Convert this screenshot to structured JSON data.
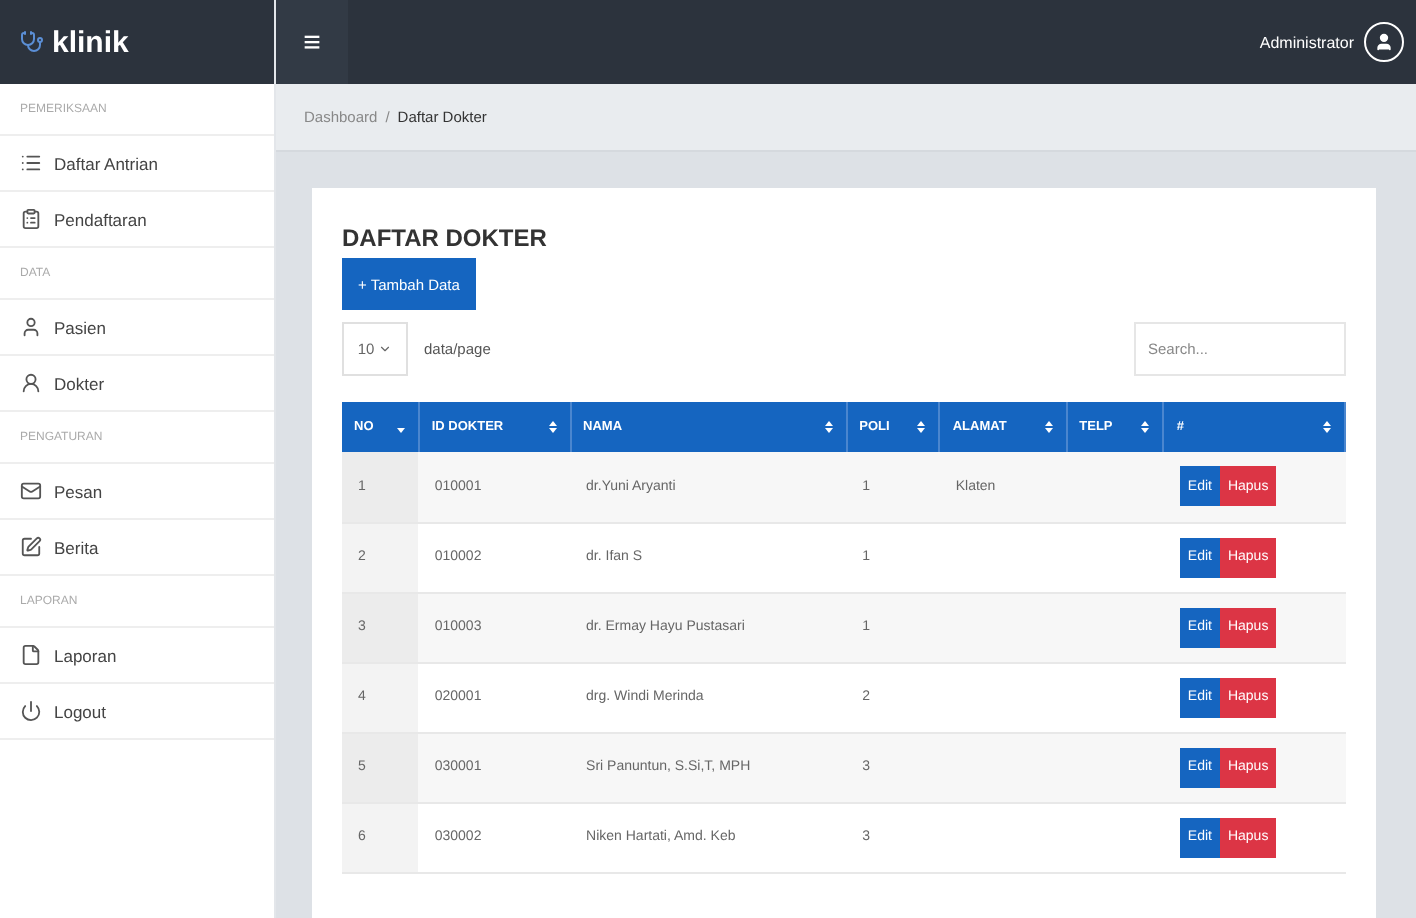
{
  "brand": "klinik",
  "topbar": {
    "menu_glyph": "≡",
    "user": "Administrator"
  },
  "sidebar": [
    {
      "kind": "header",
      "label": "PEMERIKSAAN"
    },
    {
      "kind": "item",
      "label": "Daftar Antrian"
    },
    {
      "kind": "item",
      "label": "Pendaftaran"
    },
    {
      "kind": "header",
      "label": "DATA"
    },
    {
      "kind": "item",
      "label": "Pasien"
    },
    {
      "kind": "item",
      "label": "Dokter"
    },
    {
      "kind": "header",
      "label": "PENGATURAN"
    },
    {
      "kind": "item",
      "label": "Pesan"
    },
    {
      "kind": "item",
      "label": "Berita"
    },
    {
      "kind": "header",
      "label": "LAPORAN"
    },
    {
      "kind": "item",
      "label": "Laporan"
    },
    {
      "kind": "item",
      "label": "Logout"
    }
  ],
  "breadcrumb": {
    "items": [
      "Dashboard",
      "Daftar Dokter"
    ],
    "separator": "/"
  },
  "page_title": "DAFTAR DOKTER",
  "add_button": "+ Tambah Data",
  "page_size": {
    "value": "10",
    "label": "data/page"
  },
  "search": {
    "placeholder": "Search..."
  },
  "table": {
    "columns": [
      {
        "label": "NO",
        "sorted": true
      },
      {
        "label": "ID DOKTER",
        "sorted": false
      },
      {
        "label": "NAMA",
        "sorted": false
      },
      {
        "label": "POLI",
        "sorted": false
      },
      {
        "label": "ALAMAT",
        "sorted": false
      },
      {
        "label": "TELP",
        "sorted": false
      },
      {
        "label": "#",
        "sorted": false
      }
    ],
    "rows": [
      {
        "cells": [
          "1",
          "010001",
          "dr.Yuni Aryanti",
          "1",
          "Klaten",
          ""
        ],
        "actions": [
          "Edit",
          "Hapus"
        ]
      },
      {
        "cells": [
          "2",
          "010002",
          "dr. Ifan S",
          "1",
          "",
          ""
        ],
        "actions": [
          "Edit",
          "Hapus"
        ]
      },
      {
        "cells": [
          "3",
          "010003",
          "dr. Ermay Hayu Pustasari",
          "1",
          "",
          ""
        ],
        "actions": [
          "Edit",
          "Hapus"
        ]
      },
      {
        "cells": [
          "4",
          "020001",
          "drg. Windi Merinda",
          "2",
          "",
          ""
        ],
        "actions": [
          "Edit",
          "Hapus"
        ]
      },
      {
        "cells": [
          "5",
          "030001",
          "Sri Panuntun, S.Si,T, MPH",
          "3",
          "",
          ""
        ],
        "actions": [
          "Edit",
          "Hapus"
        ]
      },
      {
        "cells": [
          "6",
          "030002",
          "Niken Hartati, Amd. Keb",
          "3",
          "",
          ""
        ],
        "actions": [
          "Edit",
          "Hapus"
        ]
      }
    ]
  }
}
